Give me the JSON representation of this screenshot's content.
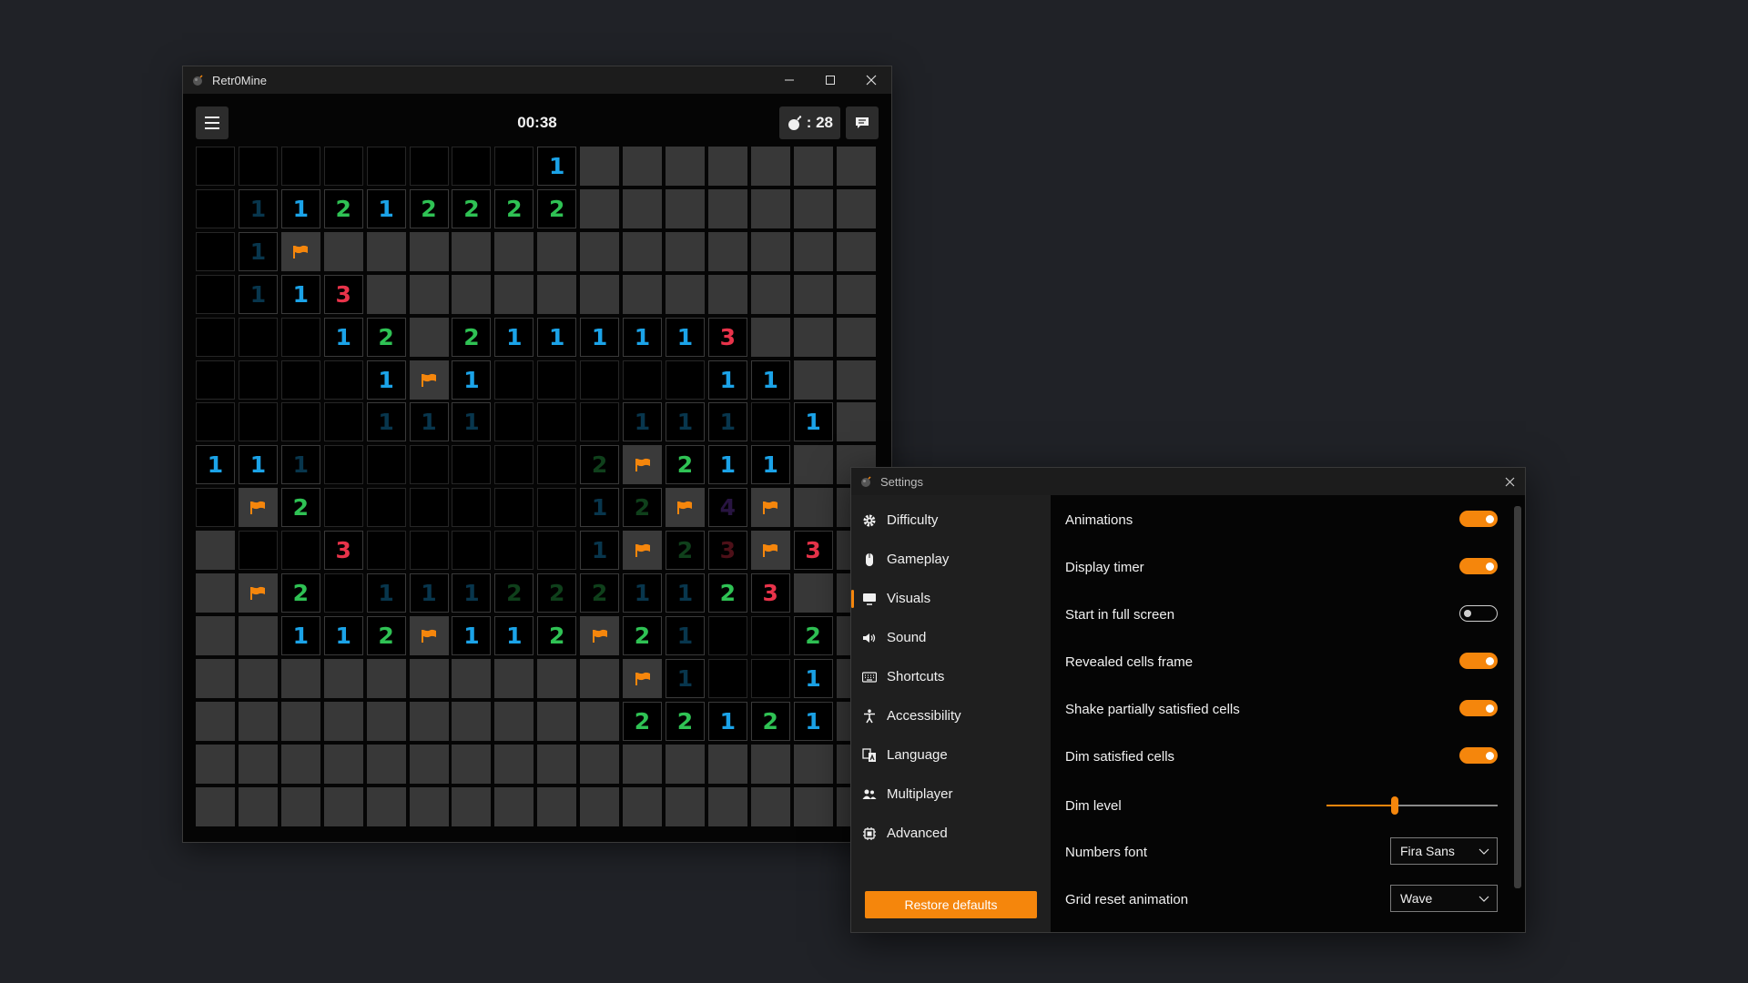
{
  "game_window": {
    "title": "Retr0Mine",
    "window_controls": {
      "minimize": "—",
      "maximize": "☐",
      "close": "✕"
    },
    "timer": "00:38",
    "mines_label": ": 28",
    "grid_rows": [
      "________1......",
      "_a1212222......",
      "_aF............",
      "_a13...........",
      "___12.2111113..",
      "____1F1_____11.",
      "____aaa___aaa_1.",
      "11a______b F211.",
      "_F2_______ab_F_dF..",
      "__3______aFbcF3.",
      "_F2_aaa_bbbaa23.",
      "__112F112F2a__2.",
      "..........Fa__1.",
      "...........22121.",
      "................",
      "................"
    ]
  },
  "board": {
    "rows": [
      "________1.......",
      "_a1212222.......",
      "_aF.............",
      "_a13............",
      "___12.2111113...",
      "____1F1_____11..",
      "____aaa___aaa_1.",
      "11a______bF211..",
      "_F2______abFdF..",
      ".__3_____aFbcF3.",
      ".F2_aaabbbaa23..",
      "..112F112F2a__2.",
      "..........Fa__1.",
      "..........22121.",
      "................",
      "................"
    ]
  },
  "settings_window": {
    "title": "Settings",
    "close": "✕",
    "nav": [
      {
        "label": "Difficulty",
        "icon": "gear-icon",
        "active": false
      },
      {
        "label": "Gameplay",
        "icon": "mouse-icon",
        "active": false
      },
      {
        "label": "Visuals",
        "icon": "monitor-icon",
        "active": true
      },
      {
        "label": "Sound",
        "icon": "speaker-icon",
        "active": false
      },
      {
        "label": "Shortcuts",
        "icon": "keyboard-icon",
        "active": false
      },
      {
        "label": "Accessibility",
        "icon": "accessibility-icon",
        "active": false
      },
      {
        "label": "Language",
        "icon": "translate-icon",
        "active": false
      },
      {
        "label": "Multiplayer",
        "icon": "people-icon",
        "active": false
      },
      {
        "label": "Advanced",
        "icon": "chip-icon",
        "active": false
      }
    ],
    "restore_defaults": "Restore defaults",
    "settings": {
      "animations": {
        "label": "Animations",
        "on": true
      },
      "display_timer": {
        "label": "Display timer",
        "on": true
      },
      "start_full_screen": {
        "label": "Start in full screen",
        "on": false
      },
      "revealed_cells_frame": {
        "label": "Revealed cells frame",
        "on": true
      },
      "shake_partially": {
        "label": "Shake partially satisfied cells",
        "on": true
      },
      "dim_satisfied": {
        "label": "Dim satisfied cells",
        "on": true
      },
      "dim_level": {
        "label": "Dim level",
        "value": 0.4
      },
      "numbers_font": {
        "label": "Numbers font",
        "value": "Fira Sans"
      },
      "grid_reset_animation": {
        "label": "Grid reset animation",
        "value": "Wave"
      }
    }
  },
  "colors": {
    "accent": "#f5860c",
    "number_1": "#1ba3e8",
    "number_2": "#2fc254",
    "number_3": "#e8334a",
    "number_4": "#7a3fc6"
  }
}
